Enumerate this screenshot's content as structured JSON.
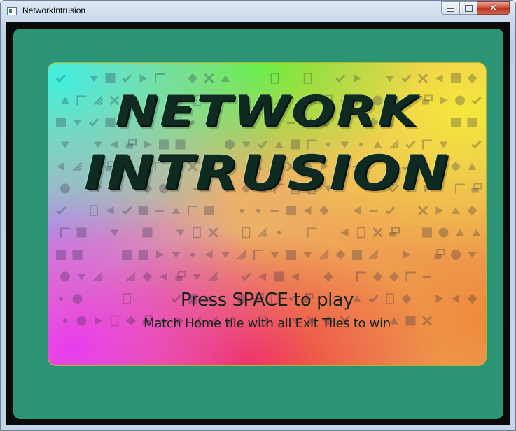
{
  "window": {
    "title": "NetworkIntrusion",
    "controls": {
      "minimize": "minimize",
      "maximize": "maximize",
      "close": "×"
    }
  },
  "game": {
    "logo_line1": "NETWORK",
    "logo_line2": "INTRUSION",
    "press_text": "Press SPACE to play",
    "hint_text": "Match Home tile with all Exit Tiles to win",
    "colors": {
      "frame": "#0a0a0a",
      "stage": "#2b9474",
      "logo_text": "#0f2a20",
      "gradient_cyan": "#3ff0e0",
      "gradient_green": "#70f030",
      "gradient_yellow": "#f4e83a",
      "gradient_magenta": "#e83cf0",
      "gradient_red": "#f03040",
      "gradient_orange": "#f08a3c"
    },
    "tile_icon_names": [
      "circle",
      "square",
      "cross",
      "diamond",
      "arrow-right",
      "arrow-left",
      "arrow-down",
      "arrow-up",
      "check",
      "corner",
      "window",
      "stripes",
      "dash",
      "small-dot",
      "unknown-box"
    ]
  }
}
